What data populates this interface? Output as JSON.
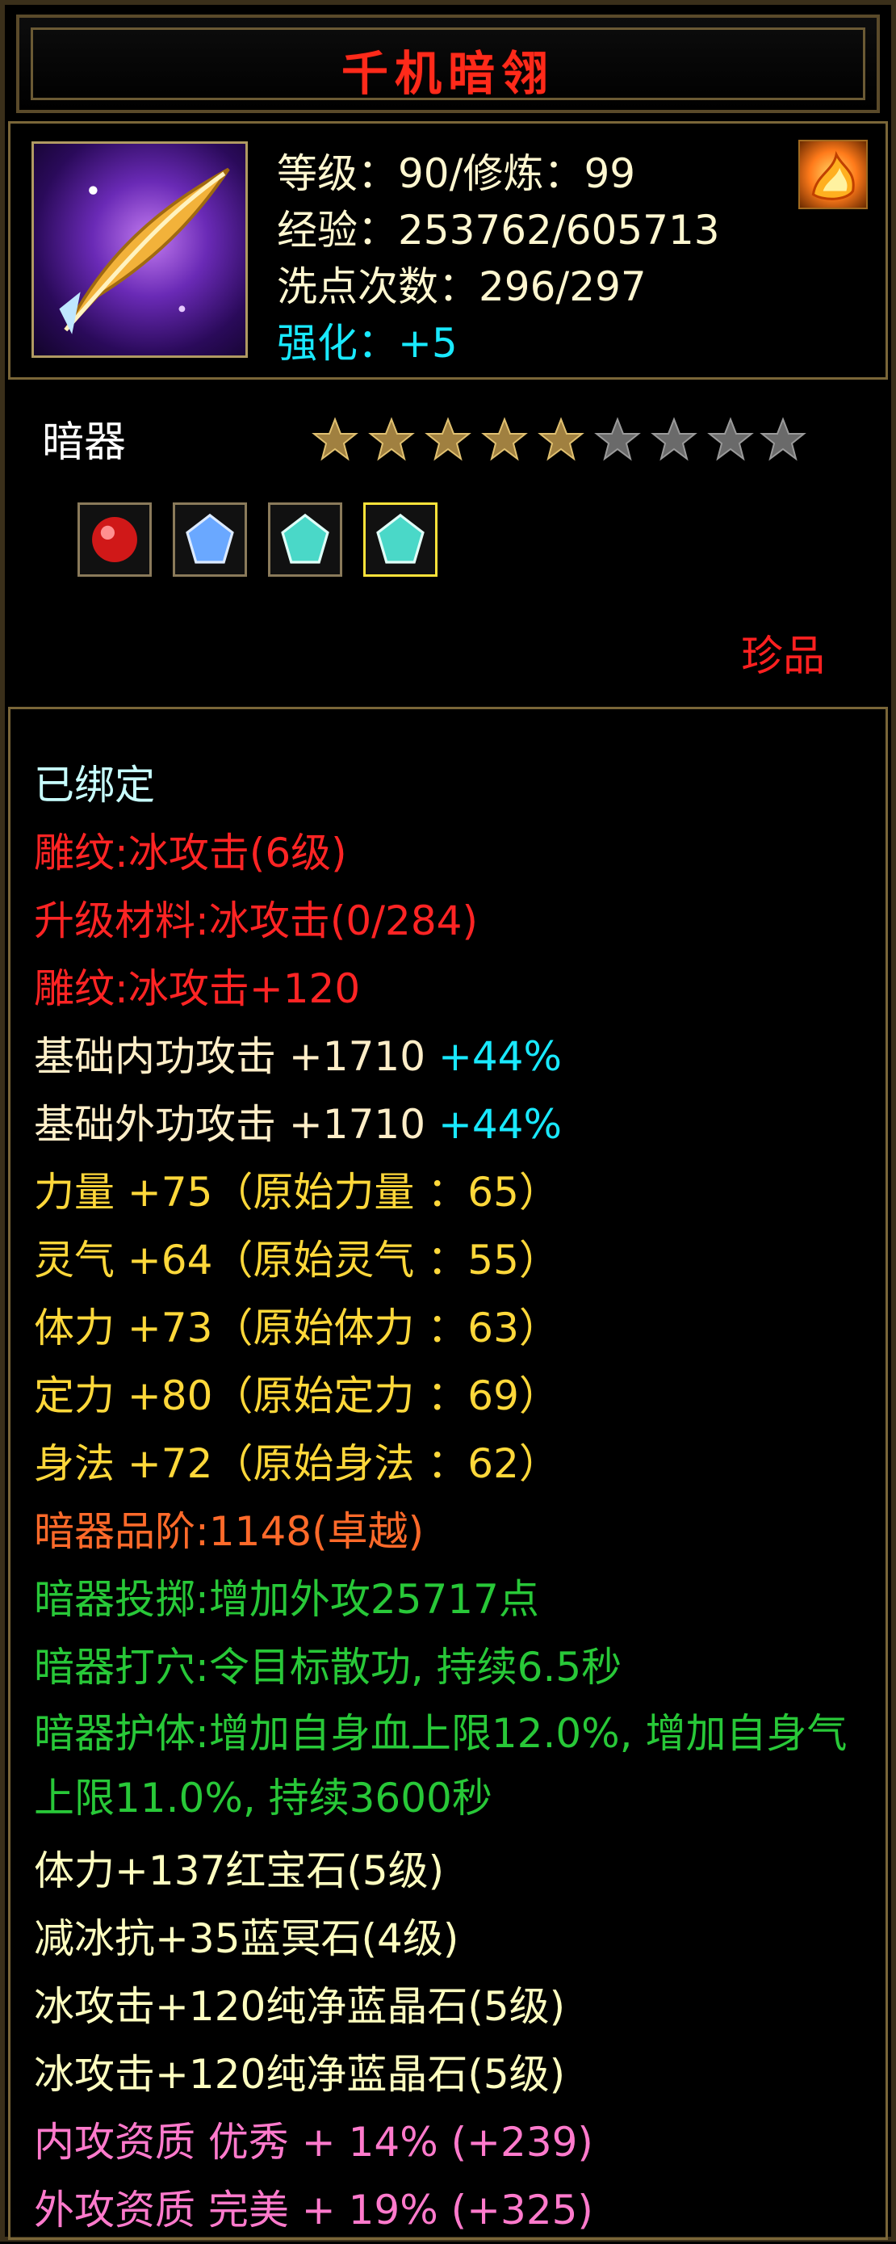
{
  "title": "千机暗翎",
  "info": {
    "level_line": "等级：90/修炼：99",
    "exp_line": "经验：253762/605713",
    "reset_line": "洗点次数：296/297",
    "enhance_line": "强化：+5"
  },
  "item_type": "暗器",
  "stars": {
    "filled": 5,
    "total": 9
  },
  "gems": [
    {
      "name": "ruby-gem-icon",
      "color": "#e02020"
    },
    {
      "name": "blue-crystal-gem-icon",
      "color": "#6aa8ff"
    },
    {
      "name": "aqua-gem-icon-1",
      "color": "#4ad8c8"
    },
    {
      "name": "aqua-gem-icon-2",
      "color": "#4ad8c8",
      "selected": true
    }
  ],
  "grade": "珍品",
  "details": {
    "bound": "已绑定",
    "engrave": "雕纹:冰攻击(6级)",
    "upgrade_material": "升级材料:冰攻击(0/284)",
    "engrave_bonus": "雕纹:冰攻击+120",
    "base_inner": "基础内功攻击 +1710",
    "base_inner_pct": "+44%",
    "base_outer": "基础外功攻击 +1710",
    "base_outer_pct": "+44%",
    "strength": "力量 +75（原始力量  ：65）",
    "spirit": "灵气 +64（原始灵气  ：55）",
    "stamina": "体力 +73（原始体力  ：63）",
    "focus": "定力 +80（原始定力  ：69）",
    "agility": "身法 +72（原始身法  ：62）",
    "rank": "暗器品阶:1148(卓越)",
    "throw": "暗器投掷:增加外攻25717点",
    "acupoint": "暗器打穴:令目标散功, 持续6.5秒",
    "guard": "暗器护体:增加自身血上限12.0%, 增加自身气上限11.0%, 持续3600秒",
    "gem1": "体力+137红宝石(5级)",
    "gem2": "减冰抗+35蓝冥石(4级)",
    "gem3": "冰攻击+120纯净蓝晶石(5级)",
    "gem4": "冰攻击+120纯净蓝晶石(5级)",
    "inner_quality": "内攻资质 优秀 + 14% (+239)",
    "outer_quality": "外攻资质 完美 + 19% (+325)"
  },
  "colors": {
    "title": "#ff2a1a",
    "enhance": "#19e9ff",
    "engrave": "#ff2424",
    "attributes": "#ffd83a",
    "rank": "#ff6a2a",
    "skills": "#28c838",
    "quality": "#ff7acc"
  }
}
